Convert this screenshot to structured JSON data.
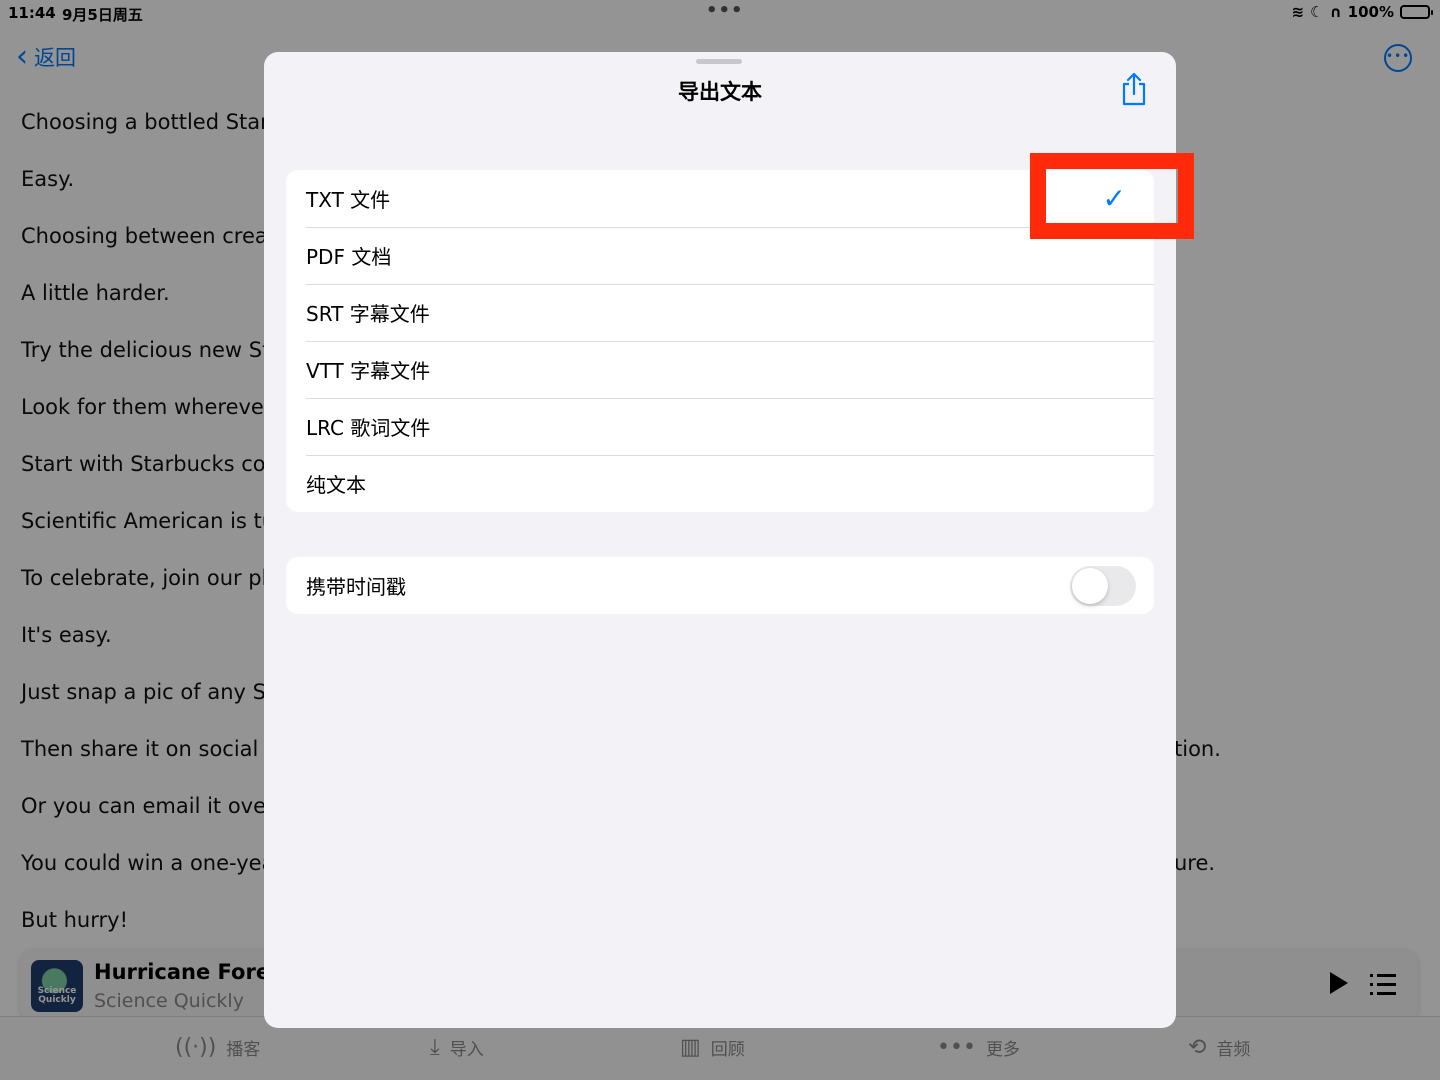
{
  "status_bar": {
    "time": "11:44",
    "date": "9月5日周五",
    "battery": "100%"
  },
  "nav": {
    "back_label": "返回"
  },
  "transcript": [
    "Choosing a bottled Starb",
    "Easy.",
    "Choosing between cream",
    "A little harder.",
    "Try the delicious new Sta",
    "Look for them wherever y",
    "Start with Starbucks coff",
    "Scientific American is tur",
    "To celebrate, join our pho",
    "It's easy.",
    "Just snap a pic of any Sc",
    "Then share it on social m",
    "Or you can email it over t",
    "You could win a one-year",
    "But hurry!"
  ],
  "transcript_right_fragments": {
    "line12": "tion.",
    "line14": "ure."
  },
  "mini_player": {
    "title": "Hurricane Foreca",
    "subtitle": "Science Quickly",
    "art_text": "Science Quickly"
  },
  "tab_bar": [
    {
      "label": "播客",
      "icon": "podcast-icon"
    },
    {
      "label": "导入",
      "icon": "import-icon"
    },
    {
      "label": "回顾",
      "icon": "book-icon"
    },
    {
      "label": "更多",
      "icon": "more-icon"
    },
    {
      "label": "音频",
      "icon": "audio-icon"
    }
  ],
  "sheet": {
    "title": "导出文本",
    "formats": [
      {
        "label": "TXT 文件",
        "selected": true
      },
      {
        "label": "PDF 文档",
        "selected": false
      },
      {
        "label": "SRT 字幕文件",
        "selected": false
      },
      {
        "label": "VTT 字幕文件",
        "selected": false
      },
      {
        "label": "LRC 歌词文件",
        "selected": false
      },
      {
        "label": "纯文本",
        "selected": false
      }
    ],
    "timestamp_option": {
      "label": "携带时间戳",
      "enabled": false
    }
  },
  "colors": {
    "accent": "#007aff",
    "highlight": "#ff2a0a",
    "sheet_bg": "#f2f2f7"
  }
}
